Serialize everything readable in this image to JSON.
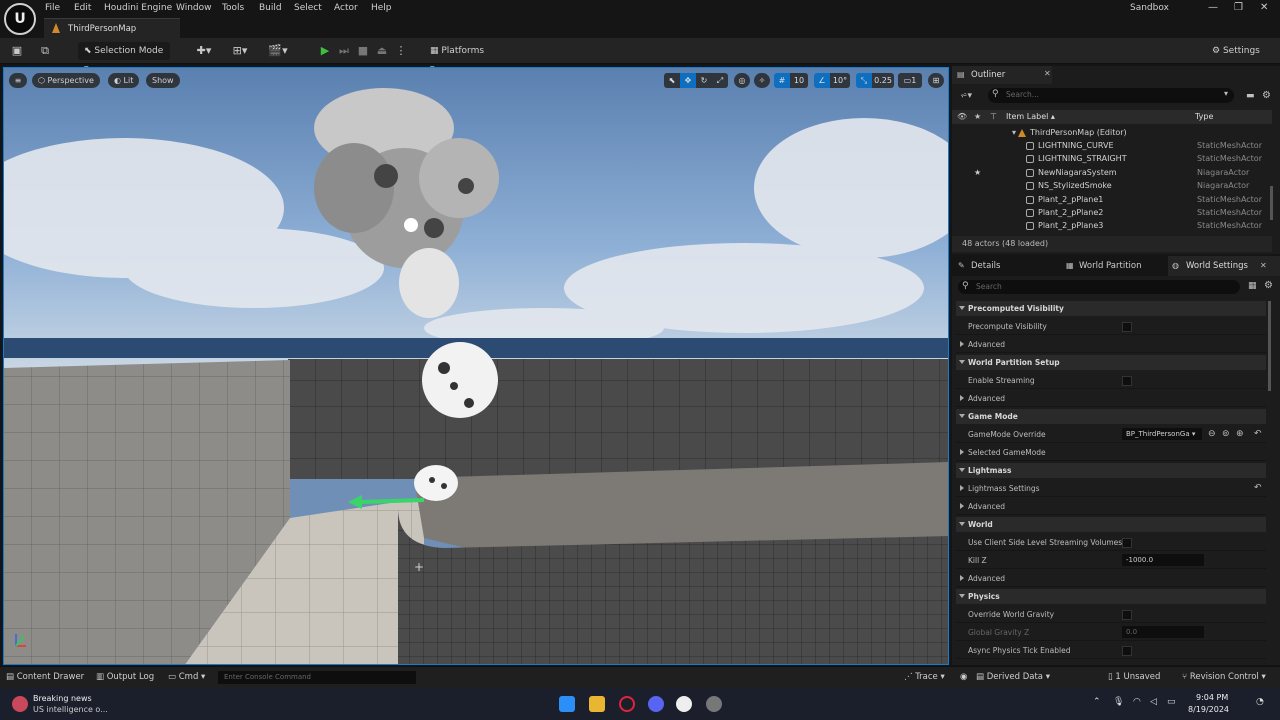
{
  "menu": {
    "items": [
      "File",
      "Edit",
      "Houdini Engine",
      "Window",
      "Tools",
      "Build",
      "Select",
      "Actor",
      "Help"
    ],
    "project": "Sandbox"
  },
  "tab": {
    "label": "ThirdPersonMap"
  },
  "toolbar": {
    "selection_mode": "Selection Mode",
    "platforms": "Platforms",
    "settings": "Settings"
  },
  "viewport": {
    "perspective": "Perspective",
    "lit": "Lit",
    "show": "Show",
    "grid_size": "10",
    "rotation_snap": "10°",
    "scale_snap": "0.25",
    "camera_speed": "1"
  },
  "outliner": {
    "title": "Outliner",
    "search_placeholder": "Search...",
    "col_label": "Item Label",
    "col_type": "Type",
    "root": "ThirdPersonMap (Editor)",
    "rows": [
      {
        "name": "LIGHTNING_CURVE",
        "type": "StaticMeshActor"
      },
      {
        "name": "LIGHTNING_STRAIGHT",
        "type": "StaticMeshActor"
      },
      {
        "name": "NewNiagaraSystem",
        "type": "NiagaraActor"
      },
      {
        "name": "NS_StylizedSmoke",
        "type": "NiagaraActor"
      },
      {
        "name": "Plant_2_pPlane1",
        "type": "StaticMeshActor"
      },
      {
        "name": "Plant_2_pPlane2",
        "type": "StaticMeshActor"
      },
      {
        "name": "Plant_2_pPlane3",
        "type": "StaticMeshActor"
      }
    ],
    "footer": "48 actors (48 loaded)"
  },
  "details": {
    "tabs": [
      "Details",
      "World Partition",
      "World Settings"
    ],
    "search_placeholder": "Search",
    "sections": {
      "precomputed": "Precomputed Visibility",
      "precompute_visibility": "Precompute Visibility",
      "advanced": "Advanced",
      "world_partition": "World Partition Setup",
      "enable_streaming": "Enable Streaming",
      "game_mode": "Game Mode",
      "gamemode_override": "GameMode Override",
      "gamemode_value": "BP_ThirdPersonGa",
      "selected_gamemode": "Selected GameMode",
      "lightmass": "Lightmass",
      "lightmass_settings": "Lightmass Settings",
      "world": "World",
      "client_side": "Use Client Side Level Streaming Volumes",
      "kill_z": "Kill Z",
      "kill_z_value": "-1000.0",
      "physics": "Physics",
      "override_gravity": "Override World Gravity",
      "global_gravity": "Global Gravity Z",
      "global_gravity_value": "0.0",
      "async_physics": "Async Physics Tick Enabled"
    }
  },
  "bottombar": {
    "content_drawer": "Content Drawer",
    "output_log": "Output Log",
    "cmd": "Cmd",
    "console_placeholder": "Enter Console Command",
    "trace": "Trace",
    "derived_data": "Derived Data",
    "unsaved": "1 Unsaved",
    "revision_control": "Revision Control"
  },
  "taskbar": {
    "news_title": "Breaking news",
    "news_sub": "US intelligence o...",
    "time": "9:04 PM",
    "date": "8/19/2024"
  }
}
